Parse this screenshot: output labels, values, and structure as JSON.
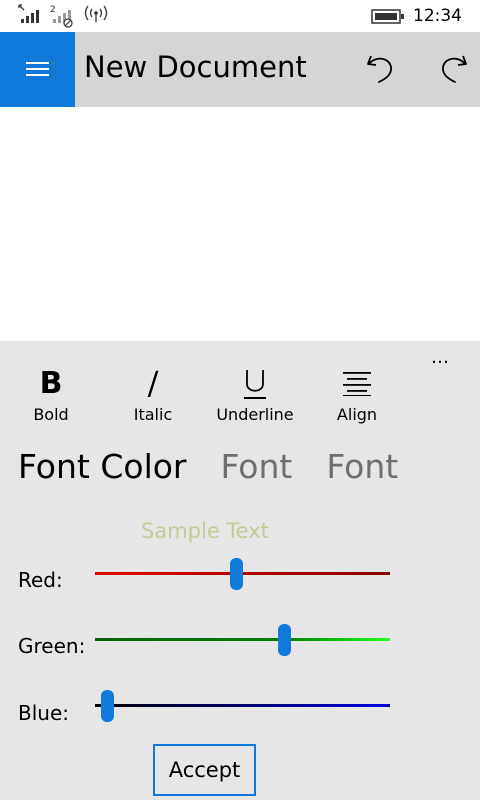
{
  "status_bar": {
    "time": "12:34",
    "sim2_label": "2",
    "icons": [
      "signal-icon",
      "signal-no-sim-icon",
      "wifi-icon",
      "battery-icon"
    ]
  },
  "header": {
    "title": "New Document",
    "menu_icon": "hamburger-icon",
    "undo_icon": "undo-icon",
    "redo_icon": "redo-icon",
    "accent_color": "#0f7ad9"
  },
  "toolbar": {
    "more_label": "…",
    "bold": {
      "label": "Bold",
      "glyph": "B"
    },
    "italic": {
      "label": "Italic",
      "glyph": "/"
    },
    "underline": {
      "label": "Underline",
      "glyph": "U"
    },
    "align": {
      "label": "Align"
    }
  },
  "pivots": [
    {
      "label": "Font Color",
      "active": true
    },
    {
      "label": "Font",
      "active": false
    },
    {
      "label": "Font S",
      "active": false
    }
  ],
  "color_picker": {
    "sample_text": "Sample Text",
    "sample_color": "#c0cc97",
    "red": {
      "label": "Red:",
      "value": 0.48
    },
    "green": {
      "label": "Green:",
      "value": 0.65
    },
    "blue": {
      "label": "Blue:",
      "value": 0.02
    },
    "accept_label": "Accept"
  }
}
